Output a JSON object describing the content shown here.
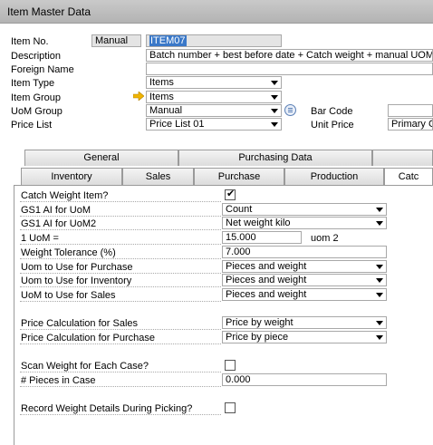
{
  "window": {
    "title": "Item Master Data"
  },
  "header": {
    "item_no_label": "Item No.",
    "item_no_mode": "Manual",
    "item_no_value": "ITEM07",
    "description_label": "Description",
    "description_value": "Batch number + best before date + Catch weight + manual UOM",
    "foreign_name_label": "Foreign Name",
    "foreign_name_value": "",
    "item_type_label": "Item Type",
    "item_type_value": "Items",
    "item_group_label": "Item Group",
    "item_group_value": "Items",
    "uom_group_label": "UoM Group",
    "uom_group_value": "Manual",
    "price_list_label": "Price List",
    "price_list_value": "Price List 01",
    "bar_code_label": "Bar Code",
    "bar_code_value": "",
    "unit_price_label": "Unit Price",
    "unit_price_value": "Primary C"
  },
  "tabs_top": [
    "General",
    "Purchasing Data",
    ""
  ],
  "tabs_sub": [
    "Inventory",
    "Sales",
    "Purchase",
    "Production",
    "Catc"
  ],
  "catch": {
    "catch_weight_item_label": "Catch Weight Item?",
    "catch_weight_item_checked": true,
    "gs1_uom_label": "GS1 AI for UoM",
    "gs1_uom_value": "Count",
    "gs1_uom2_label": "GS1 AI for UoM2",
    "gs1_uom2_value": "Net weight kilo",
    "one_uom_label": "1 UoM =",
    "one_uom_value": "15.000",
    "one_uom_unit": "uom 2",
    "weight_tol_label": "Weight Tolerance (%)",
    "weight_tol_value": "7.000",
    "uom_purchase_label": "Uom to Use for Purchase",
    "uom_purchase_value": "Pieces and weight",
    "uom_inventory_label": "Uom to Use for Inventory",
    "uom_inventory_value": "Pieces and weight",
    "uom_sales_label": "UoM to Use for Sales",
    "uom_sales_value": "Pieces and weight",
    "price_calc_sales_label": "Price Calculation for Sales",
    "price_calc_sales_value": "Price by weight",
    "price_calc_purchase_label": "Price Calculation for Purchase",
    "price_calc_purchase_value": "Price by piece",
    "scan_weight_label": "Scan Weight for Each Case?",
    "scan_weight_checked": false,
    "pieces_in_case_label": "# Pieces in Case",
    "pieces_in_case_value": "0.000",
    "record_weight_label": "Record Weight Details During Picking?",
    "record_weight_checked": false
  },
  "icons": {
    "link_arrow": "link-arrow-icon",
    "uom_group_details": "uom-group-details-icon"
  },
  "colors": {
    "selection": "#3a78c8",
    "link_arrow": "#f0b400"
  }
}
